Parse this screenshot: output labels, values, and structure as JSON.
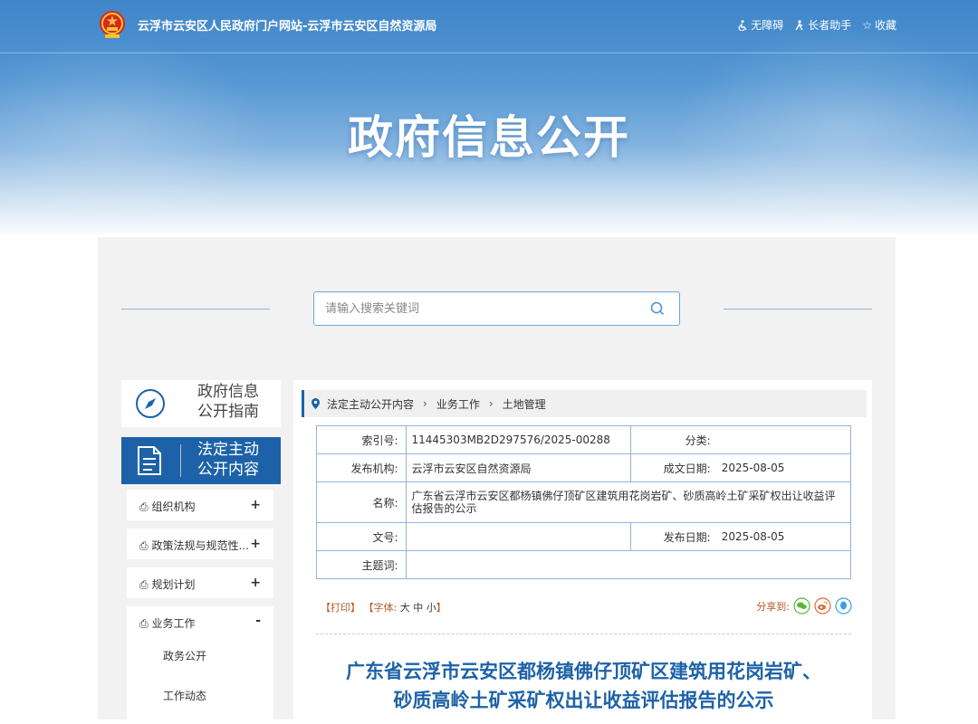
{
  "header": {
    "site_title": "云浮市云安区人民政府门户网站-云浮市云安区自然资源局",
    "links": [
      "无障碍",
      "长者助手",
      "收藏"
    ]
  },
  "hero_title": "政府信息公开",
  "search": {
    "placeholder": "请输入搜索关键词"
  },
  "sidebar": {
    "guide": [
      "政府信息",
      "公开指南"
    ],
    "active": [
      "法定主动",
      "公开内容"
    ],
    "items": [
      {
        "label": "组织机构",
        "toggle": "+"
      },
      {
        "label": "政策法规与规范性...",
        "toggle": "+"
      },
      {
        "label": "规划计划",
        "toggle": "+"
      },
      {
        "label": "业务工作",
        "toggle": "-",
        "children": [
          "政务公开",
          "工作动态"
        ]
      }
    ]
  },
  "breadcrumb": [
    "法定主动公开内容",
    "业务工作",
    "土地管理"
  ],
  "meta": {
    "index_label": "索引号:",
    "index_value": "11445303MB2D297576/2025-00288",
    "category_label": "分类:",
    "category_value": "",
    "publisher_label": "发布机构:",
    "publisher_value": "云浮市云安区自然资源局",
    "created_label": "成文日期:",
    "created_value": "2025-08-05",
    "name_label": "名称:",
    "name_value": "广东省云浮市云安区都杨镇佛仔顶矿区建筑用花岗岩矿、砂质高岭土矿采矿权出让收益评估报告的公示",
    "docno_label": "文号:",
    "docno_value": "",
    "published_label": "发布日期:",
    "published_value": "2025-08-05",
    "subject_label": "主题词:",
    "subject_value": ""
  },
  "tools": {
    "print": "【打印】",
    "font_prefix": "【字体:",
    "big": "大",
    "mid": "中",
    "small": "小",
    "font_suffix": "】"
  },
  "share_label": "分享到:",
  "article_title": [
    "广东省云浮市云安区都杨镇佛仔顶矿区建筑用花岗岩矿、",
    "砂质高岭土矿采矿权出让收益评估报告的公示"
  ],
  "colors": {
    "primary": "#1d62a8",
    "banner": "#4a8fcf",
    "wechat": "#5cb531",
    "weibo": "#e2673a",
    "qq": "#3c9fe0"
  }
}
